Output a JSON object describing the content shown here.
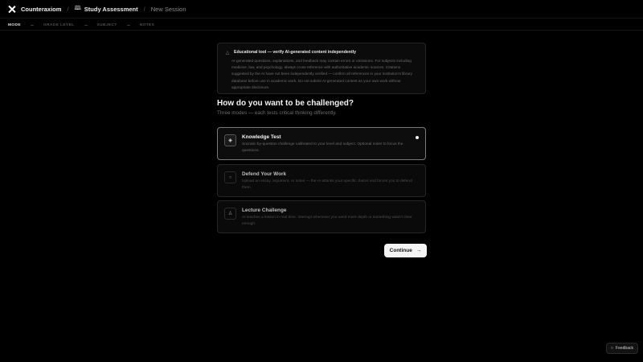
{
  "header": {
    "brand": "Counteraxiom",
    "separator": "/",
    "crumbs": [
      {
        "label": "Study Assessment",
        "icon": "book-icon"
      },
      {
        "label": "New Session"
      }
    ]
  },
  "steps": [
    {
      "label": "MODE",
      "active": true
    },
    {
      "label": "GRADE LEVEL",
      "active": false
    },
    {
      "label": "SUBJECT",
      "active": false
    },
    {
      "label": "NOTES",
      "active": false
    }
  ],
  "warning": {
    "icon": "warning-icon",
    "title": "Educational tool — verify AI-generated content independently",
    "body": "AI-generated questions, explanations, and feedback may contain errors or omissions. For subjects including medicine, law, and psychology, always cross-reference with authoritative academic sources. Citations suggested by the AI have not been independently verified — confirm all references in your institution's library database before use in academic work. Do not submit AI-generated content as your own work without appropriate disclosure."
  },
  "question": {
    "title": "How do you want to be challenged?",
    "subtitle": "Three modes — each tests critical thinking differently."
  },
  "modes": [
    {
      "title": "Knowledge Test",
      "icon": "graduation-cap-icon",
      "selected": true,
      "description": "Socratic-by-question challenge calibrated to your level and subject. Optional notes to focus the questions."
    },
    {
      "title": "Defend Your Work",
      "icon": "shield-icon",
      "selected": false,
      "description": "Upload an essay, argument, or notes — the AI attacks your specific claims and forces you to defend them."
    },
    {
      "title": "Lecture Challenge",
      "icon": "person-icon",
      "selected": false,
      "description": "AI teaches a lesson in real time. Interrupt whenever you need more depth or something wasn't clear enough."
    }
  ],
  "actions": {
    "continue_label": "Continue",
    "continue_icon": "arrow-right-icon"
  },
  "feedback": {
    "label": "Feedback",
    "icon": "chat-icon"
  },
  "colors": {
    "background": "#000000",
    "accent": "#f4f4f4",
    "muted_text": "#6e6e6e"
  }
}
